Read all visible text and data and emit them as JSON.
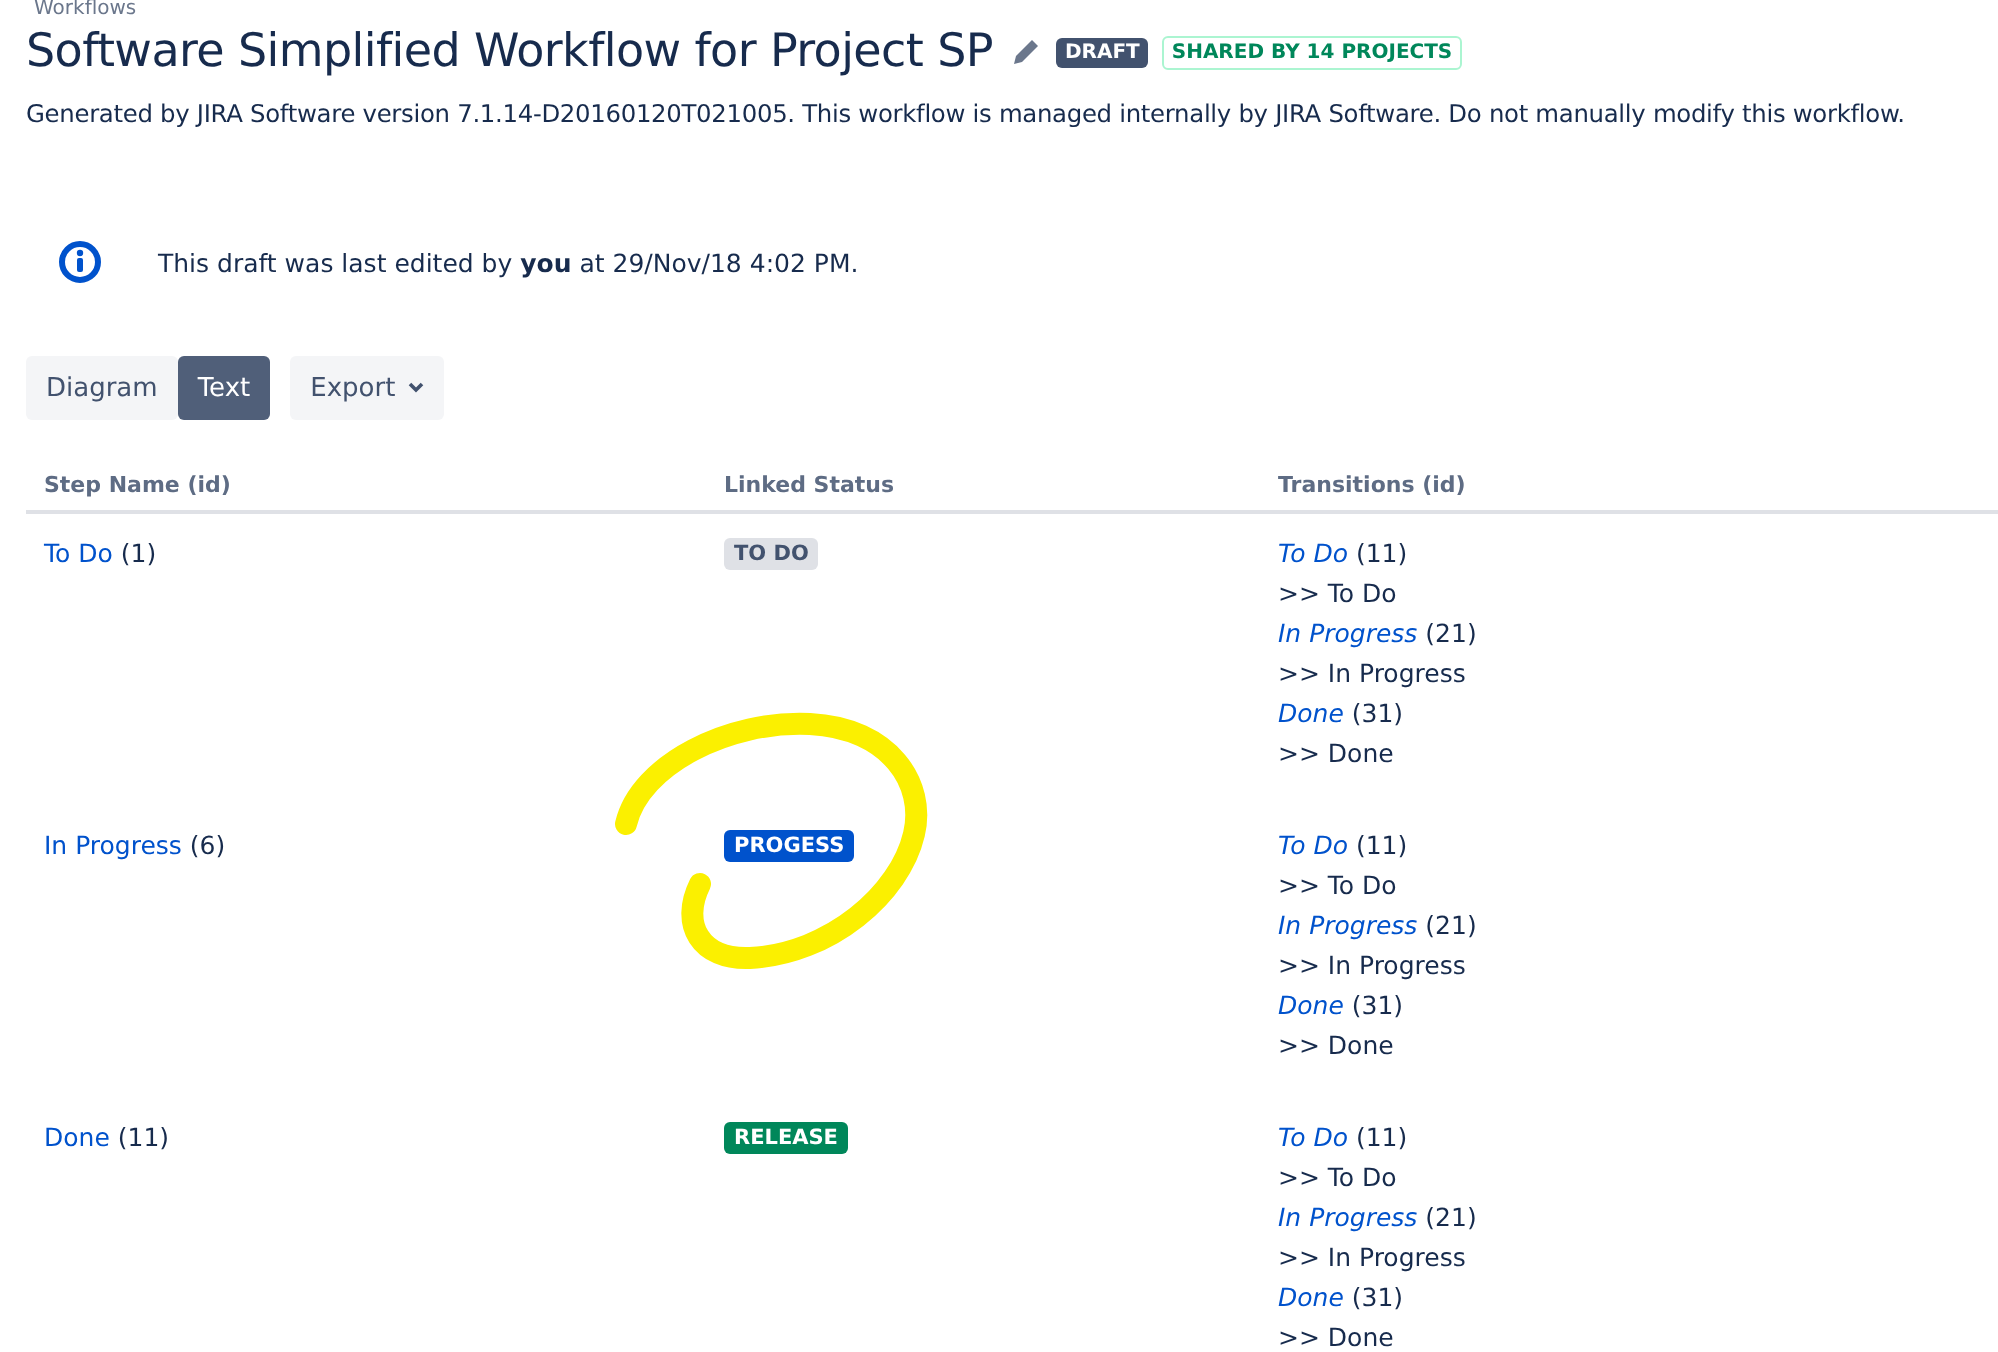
{
  "breadcrumb": "Workflows",
  "title": "Software Simplified Workflow for Project SP",
  "badges": [
    {
      "label": "DRAFT",
      "kind": "dark"
    },
    {
      "label": "SHARED BY 14 PROJECTS",
      "kind": "outline"
    }
  ],
  "description": "Generated by JIRA Software version 7.1.14-D20160120T021005. This workflow is managed internally by JIRA Software. Do not manually modify this workflow.",
  "message": "This draft was last edited by **you** at 29/Nov/18 4:02 PM.",
  "view_tabs": [
    {
      "label": "Diagram",
      "selected": false
    },
    {
      "label": "Text",
      "selected": true
    }
  ],
  "export_button": "Export",
  "table": {
    "columns": [
      "Step Name (id)",
      "Linked Status",
      "Transitions (id)"
    ],
    "rows": [
      {
        "step": "To Do",
        "id": "(1)",
        "status": {
          "label": "TO DO",
          "kind": "default"
        },
        "transitions": [
          {
            "name": "To Do",
            "id": "(11)",
            "target": ">> To Do"
          },
          {
            "name": "In Progress",
            "id": "(21)",
            "target": ">> In Progress"
          },
          {
            "name": "Done",
            "id": "(31)",
            "target": ">> Done"
          }
        ]
      },
      {
        "step": "In Progress",
        "id": "(6)",
        "status": {
          "label": "PROGESS",
          "kind": "inprogress"
        },
        "transitions": [
          {
            "name": "To Do",
            "id": "(11)",
            "target": ">> To Do"
          },
          {
            "name": "In Progress",
            "id": "(21)",
            "target": ">> In Progress"
          },
          {
            "name": "Done",
            "id": "(31)",
            "target": ">> Done"
          }
        ]
      },
      {
        "step": "Done",
        "id": "(11)",
        "status": {
          "label": "RELEASE",
          "kind": "success"
        },
        "transitions": [
          {
            "name": "To Do",
            "id": "(11)",
            "target": ">> To Do"
          },
          {
            "name": "In Progress",
            "id": "(21)",
            "target": ">> In Progress"
          },
          {
            "name": "Done",
            "id": "(31)",
            "target": ">> Done"
          }
        ]
      }
    ]
  }
}
